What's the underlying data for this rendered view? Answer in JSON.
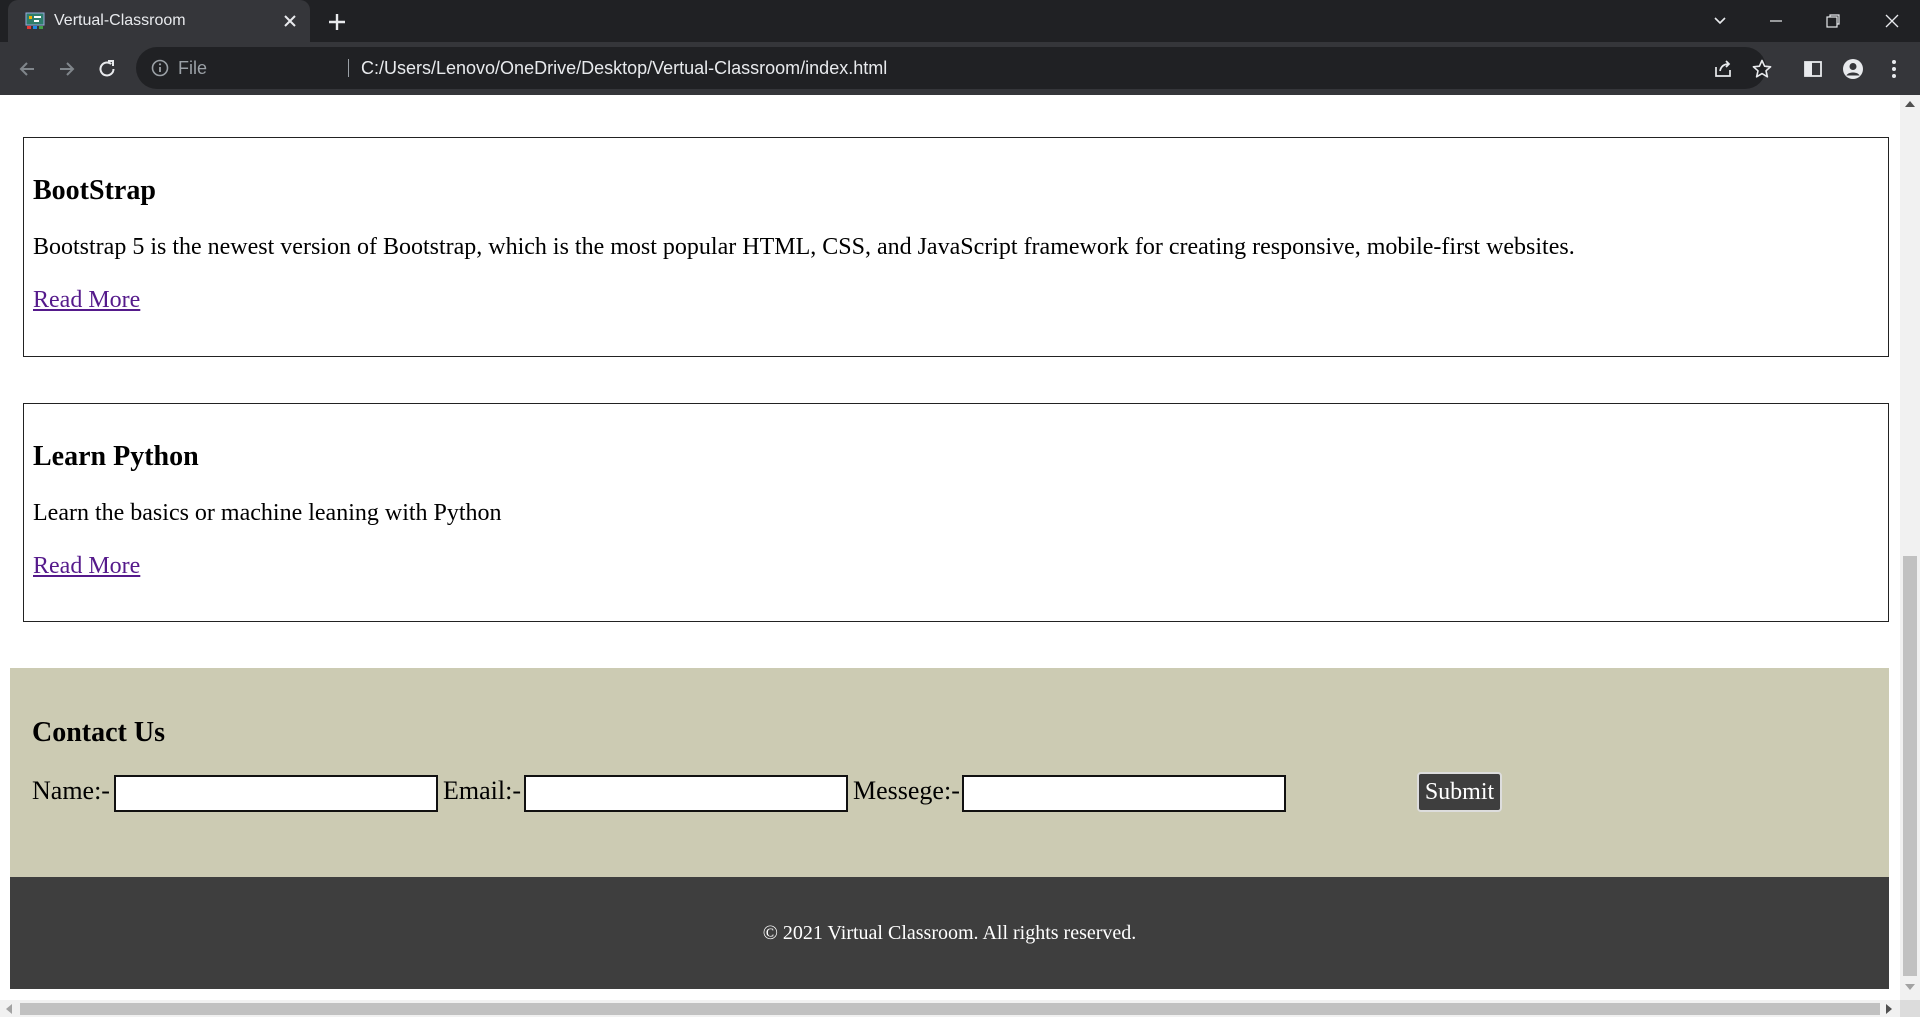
{
  "browser": {
    "tab_title": "Vertual-Classroom",
    "tab_favicon": "classroom-favicon-icon",
    "address_scheme_label": "File",
    "url": "C:/Users/Lenovo/OneDrive/Desktop/Vertual-Classroom/index.html",
    "colors": {
      "tabbar": "#202124",
      "toolbar": "#35363a",
      "omnibox": "#202124",
      "icon": "#e8eaed"
    }
  },
  "page": {
    "cards": [
      {
        "title": "BootStrap",
        "description": "Bootstrap 5 is the newest version of Bootstrap, which is the most popular HTML, CSS, and JavaScript framework for creating responsive, mobile-first websites.",
        "link": "Read More"
      },
      {
        "title": "Learn Python",
        "description": "Learn the basics or machine leaning with Python",
        "link": "Read More"
      }
    ],
    "contact": {
      "title": "Contact Us",
      "name_label": "Name:-",
      "email_label": "Email:-",
      "message_label": "Messege:-",
      "name_value": "",
      "email_value": "",
      "message_value": "",
      "submit_label": "Submit",
      "background": "#cccbb3"
    },
    "footer": {
      "text": "© 2021 Virtual Classroom. All rights reserved.",
      "background": "#3e3e3e"
    },
    "link_color": "#551a8b"
  }
}
